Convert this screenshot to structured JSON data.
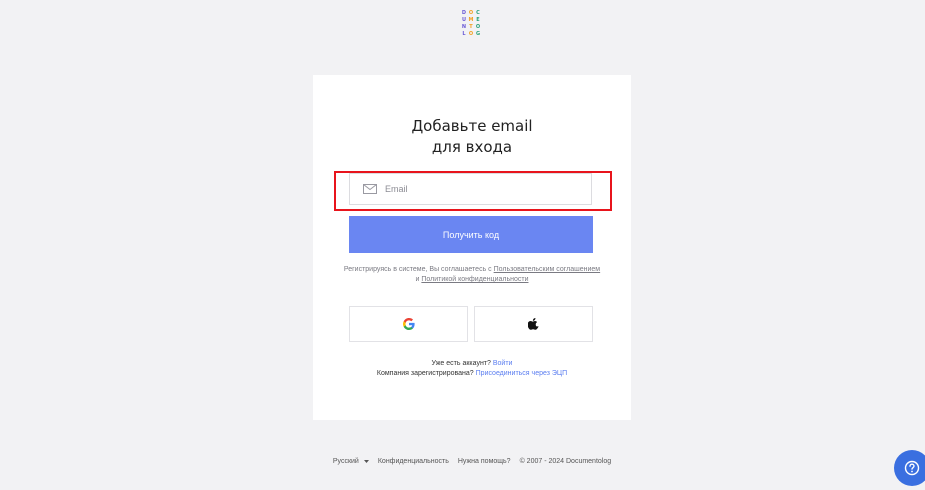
{
  "logo": {
    "letters": [
      "D",
      "O",
      "C",
      "U",
      "M",
      "E",
      "N",
      "T",
      "O",
      "L",
      "O",
      "G"
    ],
    "icon": "documentolog-logo"
  },
  "card": {
    "title_line1": "Добавьте email",
    "title_line2": "для входа",
    "email": {
      "placeholder": "Email",
      "value": "",
      "icon": "envelope-icon"
    },
    "get_code_label": "Получить код",
    "terms": {
      "prefix": "Регистрируясь в системе, Вы соглашаетесь с ",
      "user_agreement_link": "Пользовательским соглашением",
      "middle": " и ",
      "privacy_link": "Политикой конфиденциальности"
    },
    "social": {
      "google_icon": "google-icon",
      "apple_icon": "apple-icon"
    },
    "have_account_text": "Уже есть аккаунт?",
    "login_link": "Войти",
    "company_text": "Компания зарегистрирована?",
    "join_link": "Присоединиться через ЭЦП"
  },
  "footer": {
    "language": "Русский",
    "privacy": "Конфиденциальность",
    "help": "Нужна помощь?",
    "copyright": "© 2007 - 2024 Documentolog"
  },
  "colors": {
    "primary": "#6a86f2",
    "link": "#5a7df0",
    "highlight": "#e8141c",
    "background": "#f2f2f4",
    "help_button": "#3a6fe0"
  }
}
